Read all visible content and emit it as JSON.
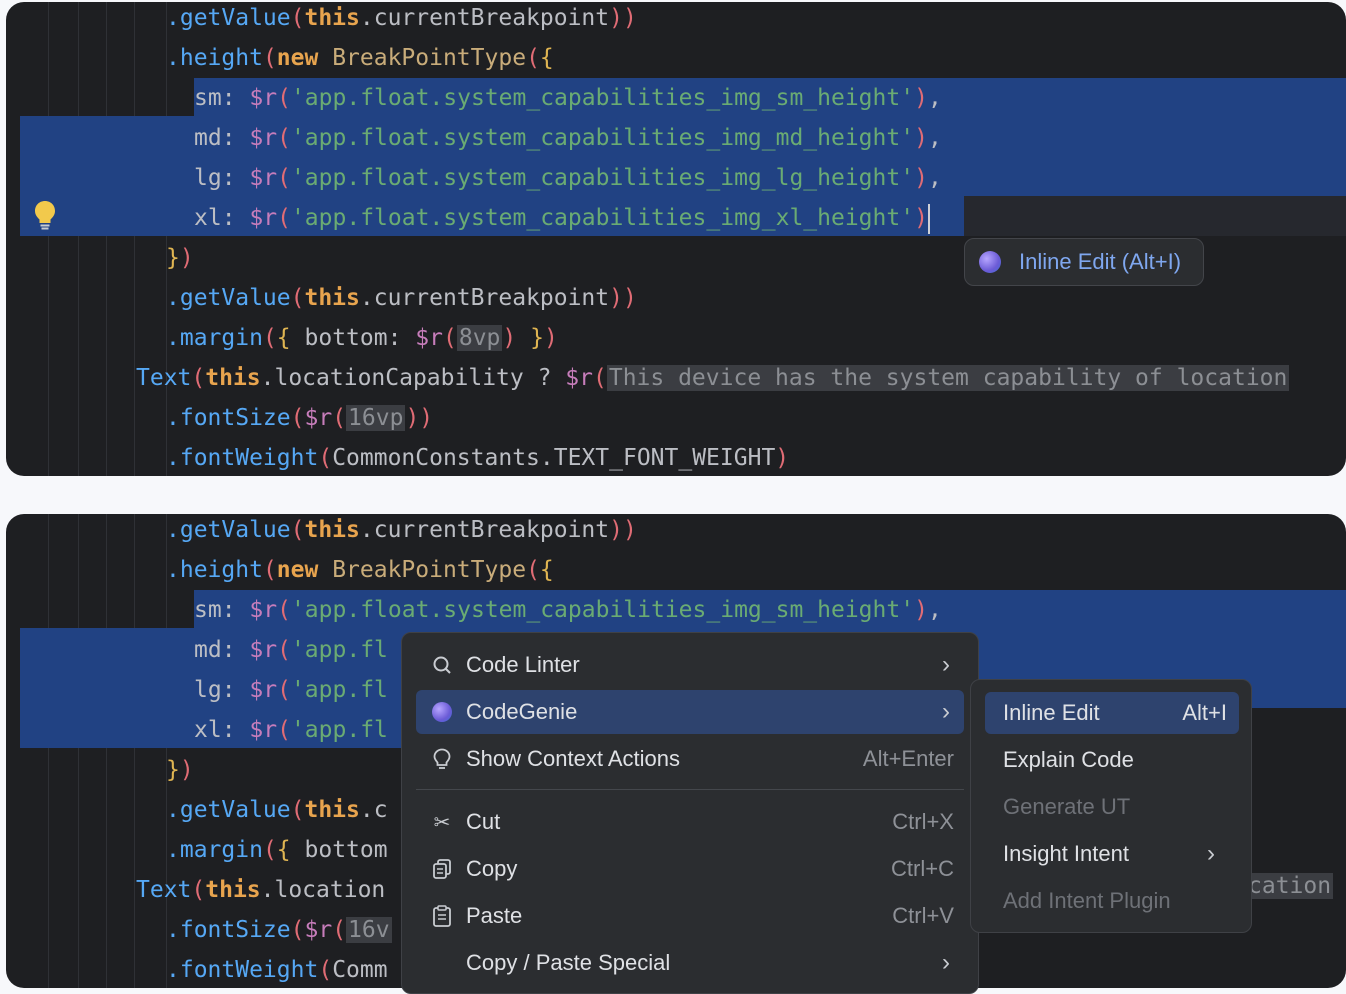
{
  "editor_top": {
    "lines": [
      {
        "t": ".getValue(this.currentBreakpoint))"
      },
      {
        "t": ".height(new BreakPointType({"
      },
      {
        "t": "sm: $r('app.float.system_capabilities_img_sm_height'),"
      },
      {
        "t": "md: $r('app.float.system_capabilities_img_md_height'),"
      },
      {
        "t": "lg: $r('app.float.system_capabilities_img_lg_height'),"
      },
      {
        "t": "xl: $r('app.float.system_capabilities_img_xl_height')"
      },
      {
        "t": "})"
      },
      {
        "t": ".getValue(this.currentBreakpoint))"
      },
      {
        "t": ".margin({ bottom: $r(8vp) })"
      },
      {
        "t": "Text(this.locationCapability ? $r(This device has the system capability of location"
      },
      {
        "t": ".fontSize($r(16vp))"
      },
      {
        "t": ".fontWeight(CommonConstants.TEXT_FONT_WEIGHT)"
      }
    ],
    "inline_edit_popup": "Inline Edit (Alt+I)"
  },
  "editor_bottom": {
    "right_fragment": "cation"
  },
  "context_menu": {
    "items": [
      {
        "label": "Code Linter",
        "shortcut": "",
        "icon": "search-icon"
      },
      {
        "label": "CodeGenie",
        "shortcut": "",
        "icon": "codegenie-icon"
      },
      {
        "label": "Show Context Actions",
        "shortcut": "Alt+Enter",
        "icon": "lightbulb-icon"
      },
      {
        "label": "Cut",
        "shortcut": "Ctrl+X",
        "icon": "scissors-icon"
      },
      {
        "label": "Copy",
        "shortcut": "Ctrl+C",
        "icon": "copy-icon"
      },
      {
        "label": "Paste",
        "shortcut": "Ctrl+V",
        "icon": "paste-icon"
      },
      {
        "label": "Copy / Paste Special",
        "shortcut": "",
        "icon": ""
      }
    ]
  },
  "codegenie_submenu": {
    "items": [
      {
        "label": "Inline Edit",
        "shortcut": "Alt+I"
      },
      {
        "label": "Explain Code",
        "shortcut": ""
      },
      {
        "label": "Generate UT",
        "shortcut": ""
      },
      {
        "label": "Insight Intent",
        "shortcut": ""
      },
      {
        "label": "Add Intent Plugin",
        "shortcut": ""
      }
    ]
  },
  "colors": {
    "editor_bg": "#1e1f22",
    "selection": "#214283",
    "menu_bg": "#2b2d30",
    "menu_active": "#2e436e",
    "method": "#56a8f5",
    "keyword": "#e8a44e",
    "string": "#6aab73"
  }
}
